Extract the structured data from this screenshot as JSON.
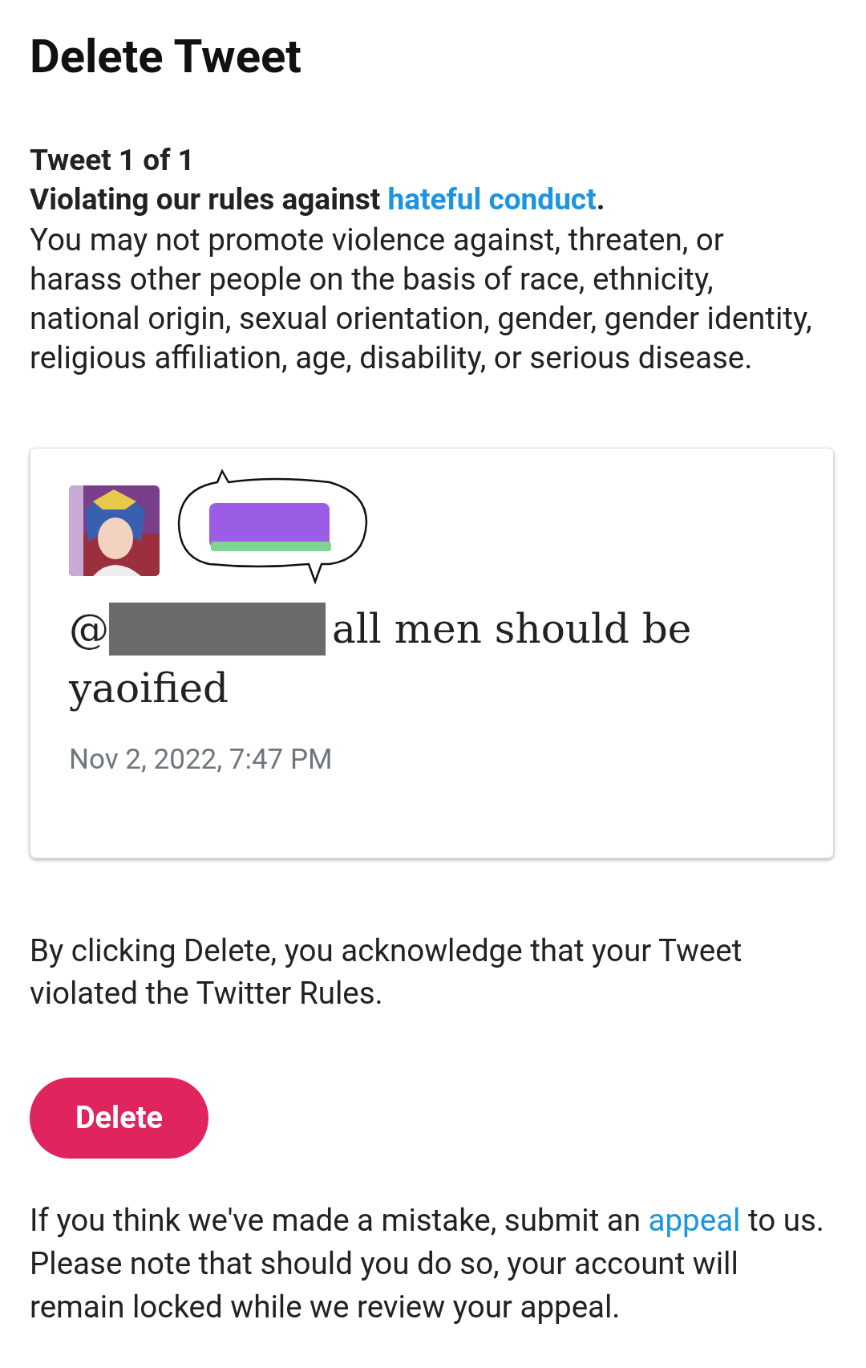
{
  "title": "Delete Tweet",
  "counter": "Tweet 1 of 1",
  "violation": {
    "lead": "Violating our rules against ",
    "link": "hateful conduct",
    "end": "."
  },
  "rule_text": "You may not promote violence against, threaten, or harass other people on the basis of race, ethnicity, national origin, sexual orientation, gender, gender identity, religious affiliation, age, disability, or serious disease.",
  "tweet": {
    "handle_prefix": "@",
    "text_lines": [
      "all men should be",
      "yaoified"
    ],
    "timestamp": "Nov 2, 2022, 7:47 PM"
  },
  "acknowledgement": "By clicking Delete, you acknowledge that your Tweet violated the Twitter Rules.",
  "delete_button": "Delete",
  "appeal": {
    "lead": "If you think we've made a mistake, submit an ",
    "link": "appeal",
    "rest": " to us. Please note that should you do so, your account will remain locked while we review your appeal."
  }
}
